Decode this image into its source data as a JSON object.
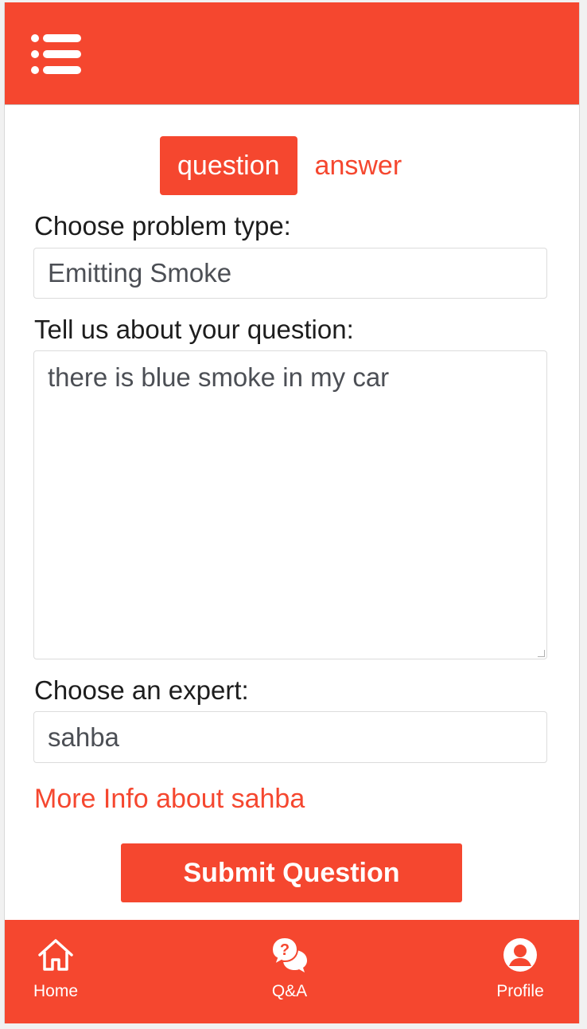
{
  "header": {
    "menu_icon": "menu-icon"
  },
  "tabs": [
    {
      "label": "question",
      "active": true
    },
    {
      "label": "answer",
      "active": false
    }
  ],
  "form": {
    "problem_type_label": "Choose problem type:",
    "problem_type_value": "Emitting Smoke",
    "question_label": "Tell us about your question:",
    "question_value": "there is blue smoke in my car",
    "expert_label": "Choose an expert:",
    "expert_value": "sahba",
    "more_info_link": "More Info about sahba",
    "submit_label": "Submit Question"
  },
  "bottom_nav": [
    {
      "label": "Home",
      "icon": "home-icon"
    },
    {
      "label": "Q&A",
      "icon": "qa-icon"
    },
    {
      "label": "Profile",
      "icon": "profile-icon"
    }
  ],
  "colors": {
    "accent": "#f5472f",
    "text": "#1d1d1d",
    "field_text": "#4c4f55"
  }
}
